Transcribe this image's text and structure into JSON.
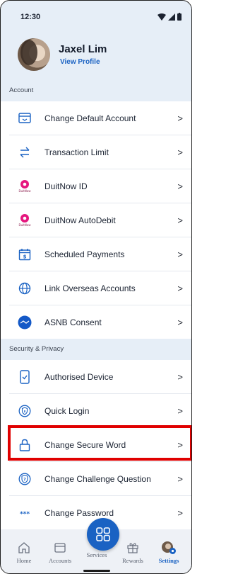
{
  "status_bar": {
    "time": "12:30"
  },
  "profile": {
    "name": "Jaxel Lim",
    "link_label": "View Profile"
  },
  "sections": {
    "account": {
      "label": "Account",
      "items": [
        {
          "label": "Change Default Account",
          "icon": "card-icon"
        },
        {
          "label": "Transaction Limit",
          "icon": "transfer-arrows-icon"
        },
        {
          "label": "DuitNow ID",
          "icon": "duitnow-icon"
        },
        {
          "label": "DuitNow AutoDebit",
          "icon": "duitnow-icon"
        },
        {
          "label": "Scheduled Payments",
          "icon": "calendar-dollar-icon"
        },
        {
          "label": "Link Overseas Accounts",
          "icon": "globe-icon"
        },
        {
          "label": "ASNB Consent",
          "icon": "asnb-icon"
        }
      ]
    },
    "security": {
      "label": "Security & Privacy",
      "items": [
        {
          "label": "Authorised Device",
          "icon": "phone-check-icon"
        },
        {
          "label": "Quick Login",
          "icon": "shield-icon"
        },
        {
          "label": "Change Secure Word",
          "icon": "lock-icon"
        },
        {
          "label": "Change Challenge Question",
          "icon": "shield-question-icon"
        },
        {
          "label": "Change Password",
          "icon": "password-dots-icon"
        }
      ]
    }
  },
  "bottom_nav": {
    "items": [
      {
        "label": "Home",
        "icon": "home-icon",
        "active": false
      },
      {
        "label": "Accounts",
        "icon": "wallet-icon",
        "active": false
      },
      {
        "label": "Services",
        "icon": "services-icon",
        "active": false
      },
      {
        "label": "Rewards",
        "icon": "gift-icon",
        "active": false
      },
      {
        "label": "Settings",
        "icon": "settings-avatar-icon",
        "active": true
      }
    ]
  },
  "colors": {
    "accent": "#1a62c3",
    "header_bg": "#e6eef7",
    "highlight": "#e00000",
    "duitnow": "#e5177e"
  }
}
